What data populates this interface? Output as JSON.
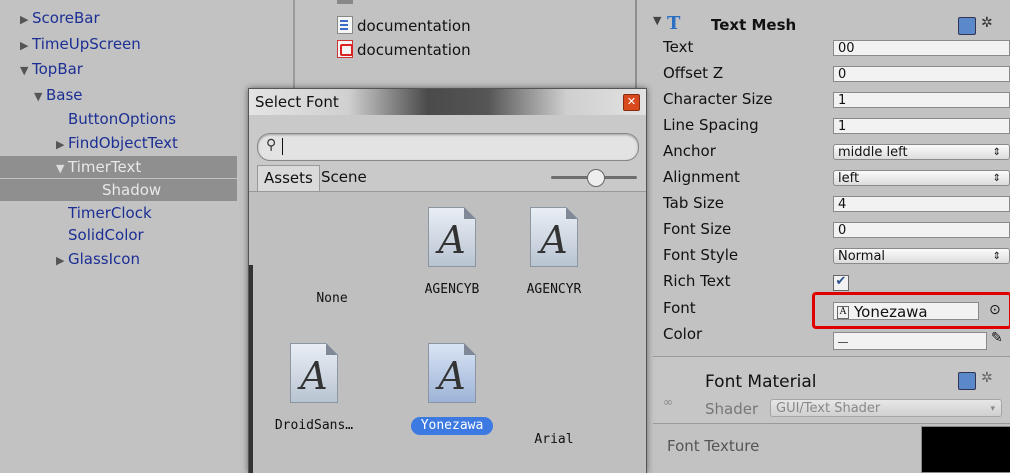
{
  "hierarchy": {
    "items": [
      {
        "label": "ScoreBar",
        "arrow": "▶",
        "indent": 0
      },
      {
        "label": "TimeUpScreen",
        "arrow": "▶",
        "indent": 0
      },
      {
        "label": "TopBar",
        "arrow": "▼",
        "indent": 0
      },
      {
        "label": "Base",
        "arrow": "▼",
        "indent": 1
      },
      {
        "label": "ButtonOptions",
        "arrow": "",
        "indent": 2
      },
      {
        "label": "FindObjectText",
        "arrow": "▶",
        "indent": 2
      },
      {
        "label": "TimerText",
        "arrow": "▼",
        "indent": 2,
        "selected": true
      },
      {
        "label": "Shadow",
        "arrow": "",
        "indent": 3,
        "selected": true
      },
      {
        "label": "TimerClock",
        "arrow": "",
        "indent": 2
      },
      {
        "label": "SolidColor",
        "arrow": "",
        "indent": 2
      },
      {
        "label": "GlassIcon",
        "arrow": "▶",
        "indent": 2
      }
    ]
  },
  "project": {
    "files": [
      {
        "label": "documentation",
        "icon": "doc-icon"
      },
      {
        "label": "documentation",
        "icon": "pdf-icon"
      }
    ]
  },
  "dialog": {
    "title": "Select Font",
    "close_glyph": "✕",
    "search_placeholder": "",
    "tabs": [
      "Assets",
      "Scene"
    ],
    "fonts": [
      {
        "label": "None",
        "has_icon": false
      },
      {
        "label": "AGENCYB",
        "has_icon": true
      },
      {
        "label": "AGENCYR",
        "has_icon": true
      },
      {
        "label": "DroidSans…",
        "has_icon": true
      },
      {
        "label": "Yonezawa",
        "has_icon": true,
        "selected": true
      },
      {
        "label": "Arial",
        "has_icon": false
      }
    ],
    "glyph": "A"
  },
  "inspector": {
    "component_title": "Text Mesh",
    "fields": [
      {
        "label": "Text",
        "value": "00",
        "kind": "text"
      },
      {
        "label": "Offset Z",
        "value": "0",
        "kind": "text"
      },
      {
        "label": "Character Size",
        "value": "1",
        "kind": "text"
      },
      {
        "label": "Line Spacing",
        "value": "1",
        "kind": "text"
      },
      {
        "label": "Anchor",
        "value": "middle left",
        "kind": "drop"
      },
      {
        "label": "Alignment",
        "value": "left",
        "kind": "drop"
      },
      {
        "label": "Tab Size",
        "value": "4",
        "kind": "text"
      },
      {
        "label": "Font Size",
        "value": "0",
        "kind": "text"
      },
      {
        "label": "Font Style",
        "value": "Normal",
        "kind": "drop"
      },
      {
        "label": "Rich Text",
        "value": "✔",
        "kind": "check"
      },
      {
        "label": "Font",
        "value": "Yonezawa",
        "kind": "font"
      },
      {
        "label": "Color",
        "value": "",
        "kind": "color"
      }
    ],
    "material_title": "Font Material",
    "shader_label": "Shader",
    "shader_value": "GUI/Text Shader",
    "font_texture_label": "Font Texture",
    "colors": {
      "highlight": "#e00000",
      "selection": "#3c7ae2"
    }
  }
}
